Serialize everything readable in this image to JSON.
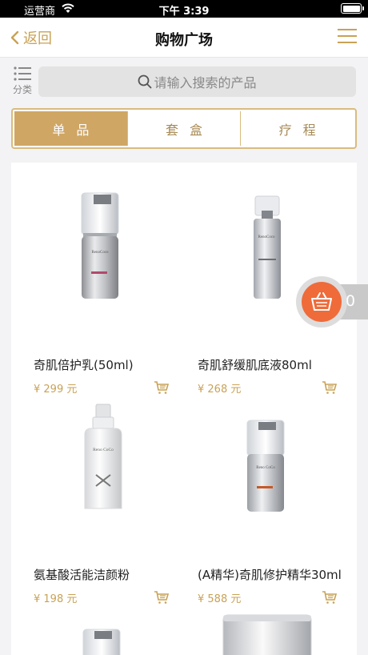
{
  "status": {
    "carrier": "运营商",
    "time": "下午 3:39"
  },
  "nav": {
    "back_label": "返回",
    "title": "购物广场"
  },
  "search": {
    "category_label": "分类",
    "placeholder": "请输入搜索的产品"
  },
  "tabs": [
    {
      "label": "单品",
      "active": true
    },
    {
      "label": "套盒",
      "active": false
    },
    {
      "label": "疗程",
      "active": false
    }
  ],
  "products": [
    {
      "name": "奇肌倍护乳(50ml)",
      "price": "¥ 299 元"
    },
    {
      "name": "奇肌舒缓肌底液80ml",
      "price": "¥ 268 元"
    },
    {
      "name": "氨基酸活能洁颜粉",
      "price": "¥ 198 元"
    },
    {
      "name": "(A精华)奇肌修护精华30ml",
      "price": "¥ 588 元"
    }
  ],
  "product_images": [
    {
      "brand": "RenoCoco"
    },
    {
      "brand": "RenoCoco"
    },
    {
      "brand": "Reno CoCo"
    },
    {
      "brand": "Reno CoCo"
    }
  ],
  "cart": {
    "count": "0"
  },
  "colors": {
    "gold": "#c9a256",
    "tab_active": "#cfa664",
    "cart_orange": "#ef6b3a"
  }
}
